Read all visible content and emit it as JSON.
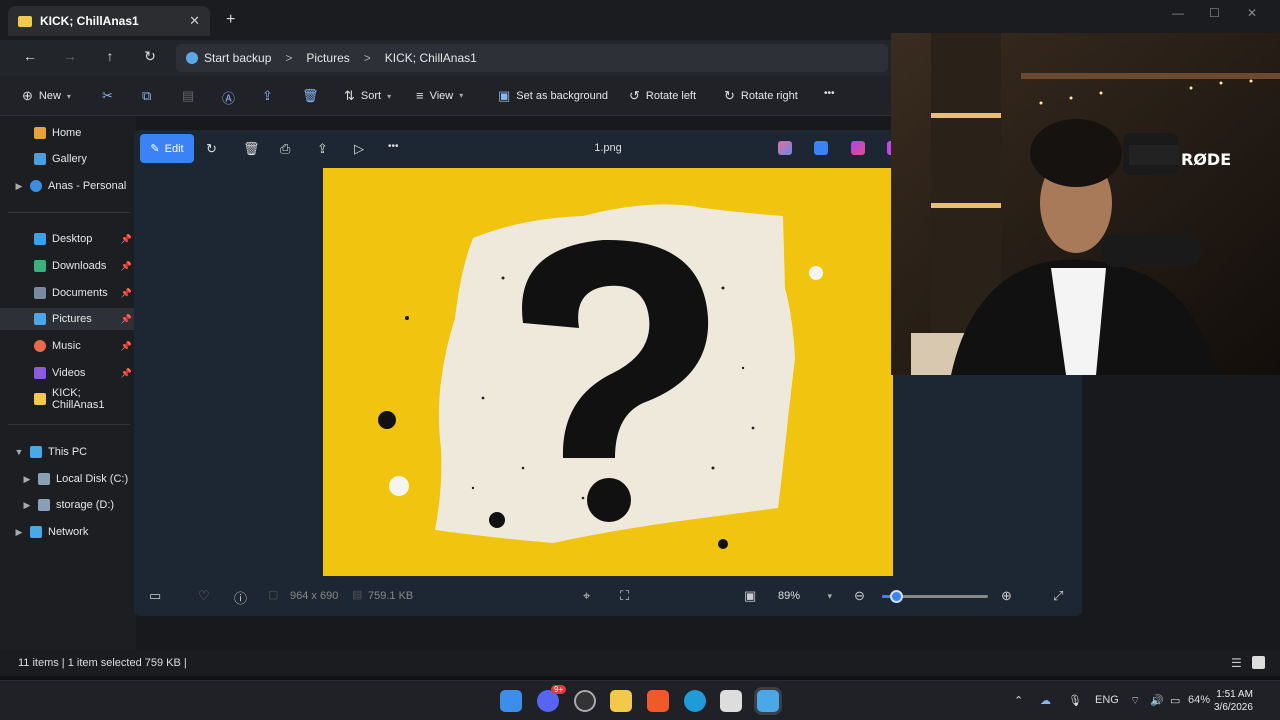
{
  "window": {
    "tab_title": "KICK; ChillAnas1",
    "new_tab": "+",
    "tab_close": "✕",
    "min": "—",
    "max": "☐",
    "close": "✕"
  },
  "address": {
    "backup_label": "Start backup",
    "crumbs": [
      "Pictures",
      "KICK; ChillAnas1"
    ],
    "separator": ">"
  },
  "commands": {
    "new": "New",
    "sort": "Sort",
    "view": "View",
    "set_background": "Set as background",
    "rotate_left": "Rotate left",
    "rotate_right": "Rotate right",
    "more": "•••"
  },
  "sidebar": {
    "items": [
      {
        "label": "Home",
        "color": "#e8a33a"
      },
      {
        "label": "Gallery",
        "color": "#4a9fe0"
      },
      {
        "label": "Anas - Personal",
        "color": "#3a8fe0"
      },
      {
        "label": "Desktop",
        "color": "#3aa0e8"
      },
      {
        "label": "Downloads",
        "color": "#3ab07a"
      },
      {
        "label": "Documents",
        "color": "#7a8aa0"
      },
      {
        "label": "Pictures",
        "color": "#4aa8e8"
      },
      {
        "label": "Music",
        "color": "#e86a4a"
      },
      {
        "label": "Videos",
        "color": "#8a5ae0"
      },
      {
        "label": "KICK; ChillAnas1",
        "color": "#f2c94c"
      },
      {
        "label": "This PC",
        "color": "#4aa8e8"
      },
      {
        "label": "Local Disk (C:)",
        "color": "#8aa0b8"
      },
      {
        "label": "storage (D:)",
        "color": "#8aa0b8"
      },
      {
        "label": "Network",
        "color": "#4aa8e8"
      }
    ]
  },
  "viewer": {
    "edit_label": "Edit",
    "filename": "1.png",
    "more": "•••",
    "dimensions": "964 x 690",
    "filesize": "759.1 KB",
    "zoom": "89%",
    "zoom_fraction": 0.13
  },
  "status": {
    "text": "11 items  |  1 item selected  759 KB  |"
  },
  "taskbar": {
    "lang": "ENG",
    "battery": "64%",
    "time": "1:51 AM",
    "date": "3/6/2026",
    "badge": "9+"
  },
  "colors": {
    "accent": "#3b82f6",
    "photo_bg": "#f1c40f",
    "viewer_bg": "#1d2733"
  }
}
